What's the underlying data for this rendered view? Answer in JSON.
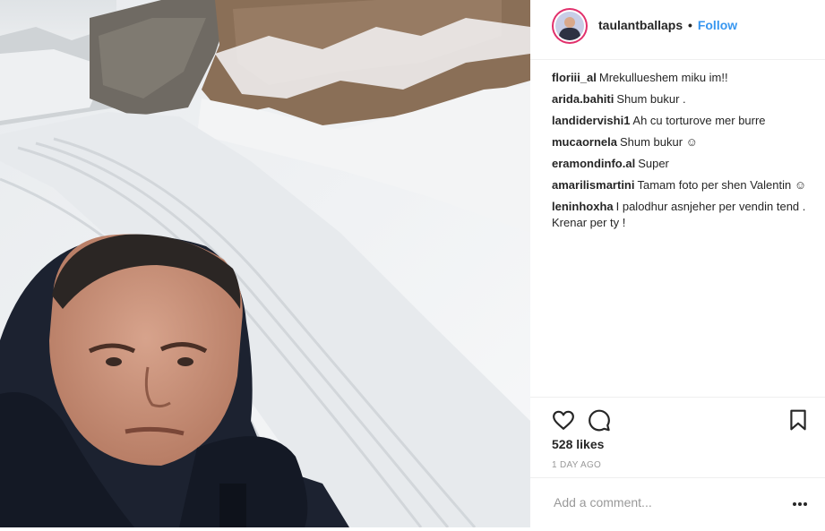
{
  "post": {
    "username": "taulantballaps",
    "follow_label": "Follow",
    "separator": "•"
  },
  "comments": [
    {
      "user": "floriii_al",
      "text": "Mrekullueshem miku im!!"
    },
    {
      "user": "arida.bahiti",
      "text": "Shum bukur ."
    },
    {
      "user": "landidervishi1",
      "text": "Ah cu torturove mer burre"
    },
    {
      "user": "mucaornela",
      "text": "Shum bukur ☺"
    },
    {
      "user": "eramondinfo.al",
      "text": "Super"
    },
    {
      "user": "amarilismartini",
      "text": "Tamam foto per shen Valentin ☺"
    },
    {
      "user": "leninhoxha",
      "text": "I palodhur asnjeher per vendin tend . Krenar per ty !"
    }
  ],
  "actions": {
    "likes": "528 likes",
    "time": "1 DAY AGO"
  },
  "comment_box": {
    "placeholder": "Add a comment..."
  },
  "icons": {
    "like": "heart-icon",
    "comment": "comment-bubble-icon",
    "save": "bookmark-icon",
    "more": "more-options-icon"
  },
  "colors": {
    "link": "#3897f0",
    "text": "#262626",
    "muted": "#999999",
    "border": "#efefef"
  }
}
